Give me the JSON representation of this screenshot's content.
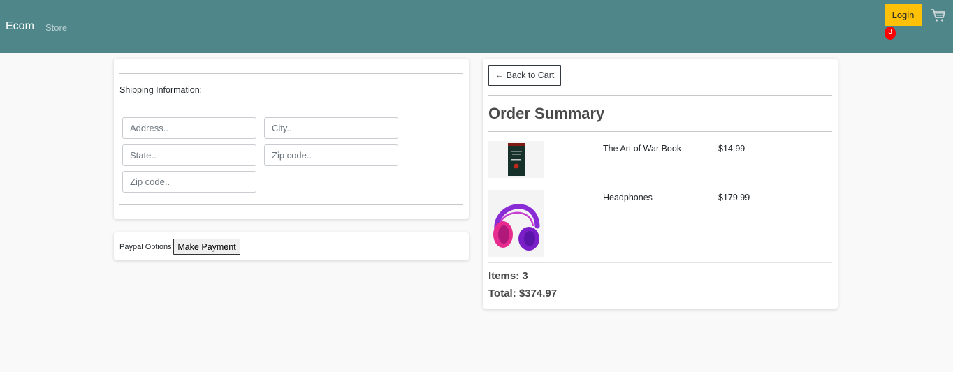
{
  "navbar": {
    "brand": "Ecom",
    "store_link": "Store",
    "login_label": "Login",
    "cart_count": "3",
    "colors": {
      "background": "#4f868a",
      "login_button": "#ffc107",
      "badge": "#ff0000"
    }
  },
  "shipping": {
    "title": "Shipping Information:",
    "fields": {
      "address": {
        "placeholder": "Address..",
        "value": ""
      },
      "city": {
        "placeholder": "City..",
        "value": ""
      },
      "state": {
        "placeholder": "State..",
        "value": ""
      },
      "zip": {
        "placeholder": "Zip code..",
        "value": ""
      },
      "zip_second": {
        "placeholder": "Zip code..",
        "value": ""
      }
    }
  },
  "payment": {
    "label": "Paypal Options",
    "button": "Make Payment"
  },
  "summary": {
    "back_button": "← Back to Cart",
    "title": "Order Summary",
    "items": [
      {
        "name": "The Art of War Book",
        "price": "$14.99",
        "image": "book-cover-icon"
      },
      {
        "name": "Headphones",
        "price": "$179.99",
        "image": "headphones-icon"
      }
    ],
    "items_text": "Items: 3",
    "total_text": "Total: $374.97"
  }
}
